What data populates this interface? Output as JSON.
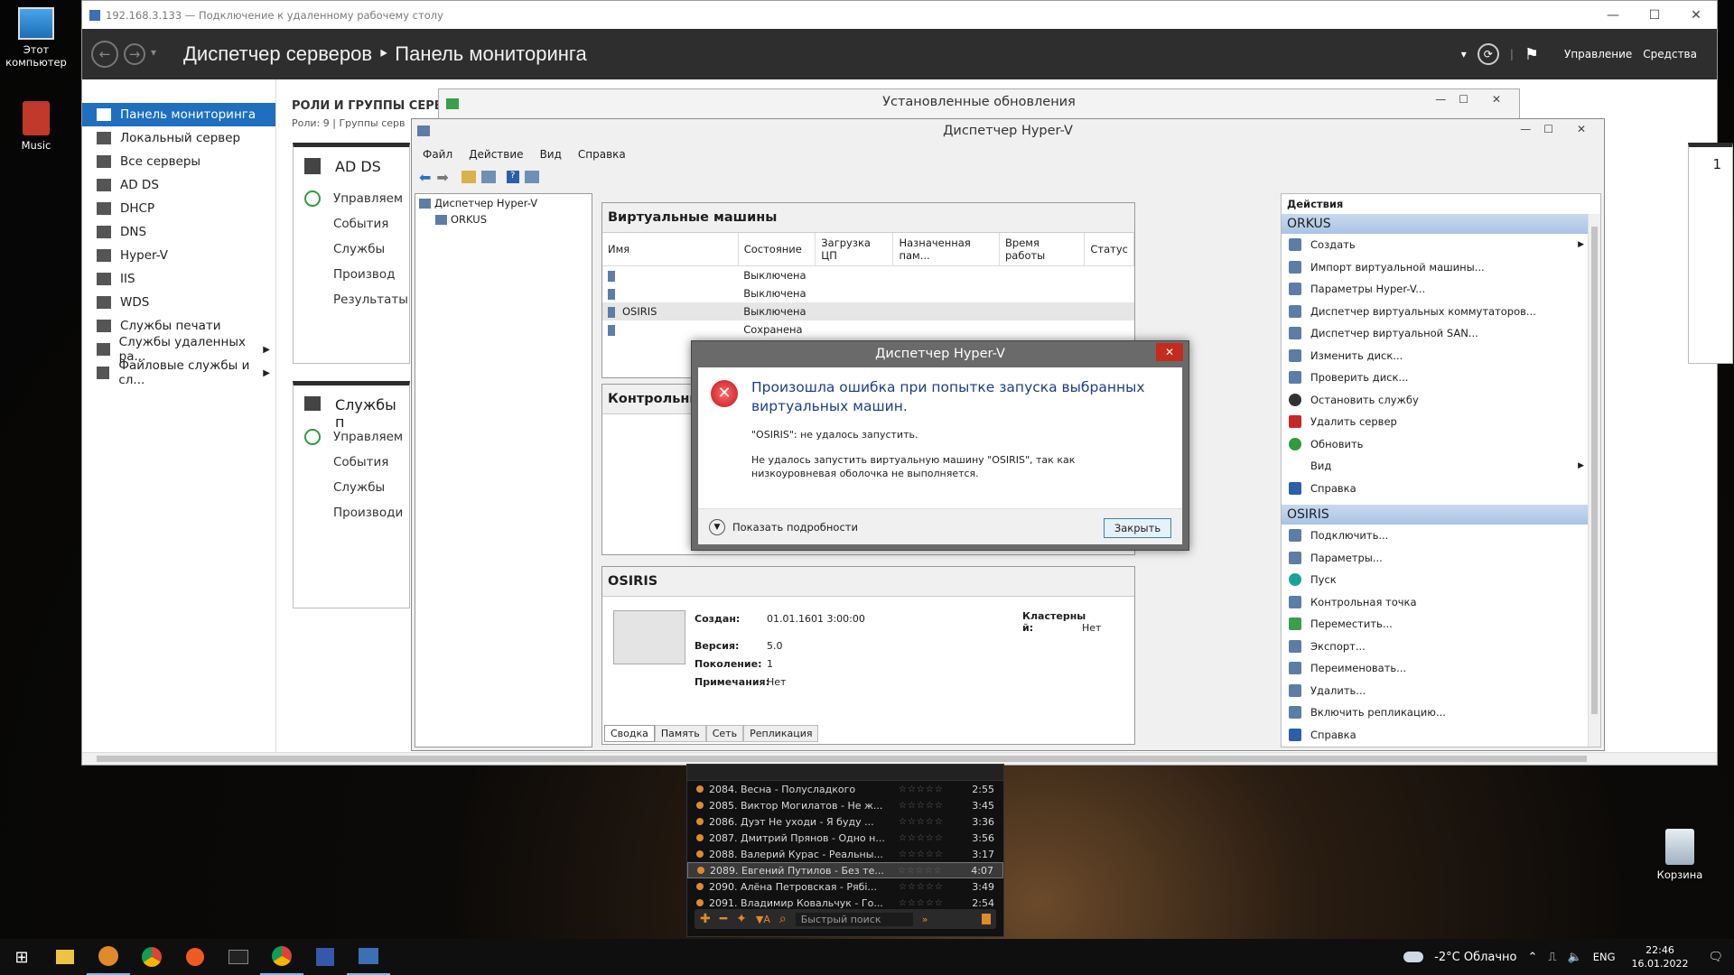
{
  "desktop": {
    "icons": [
      "Этот компьютер",
      "Music",
      "Корзина"
    ]
  },
  "rdp": {
    "title": "192.168.3.133 — Подключение к удаленному рабочему столу"
  },
  "server_manager": {
    "breadcrumb": "Диспетчер серверов ‣ Панель мониторинга",
    "header_right": [
      "Управление",
      "Средства"
    ],
    "nav": [
      {
        "label": "Панель мониторинга",
        "active": true
      },
      {
        "label": "Локальный сервер"
      },
      {
        "label": "Все серверы"
      },
      {
        "label": "AD DS"
      },
      {
        "label": "DHCP"
      },
      {
        "label": "DNS"
      },
      {
        "label": "Hyper-V"
      },
      {
        "label": "IIS"
      },
      {
        "label": "WDS"
      },
      {
        "label": "Службы печати"
      },
      {
        "label": "Службы удаленных ра..."
      },
      {
        "label": "Файловые службы и сл..."
      }
    ],
    "roles_heading": "РОЛИ И ГРУППЫ СЕРВ",
    "roles_sub": "Роли: 9 | Группы серв",
    "tile1": {
      "title": "AD DS",
      "rows": [
        "Управляем",
        "События",
        "Службы",
        "Производ",
        "Результаты"
      ]
    },
    "tile2": {
      "title": "Службы п",
      "rows": [
        "Управляем",
        "События",
        "Службы",
        "Производи"
      ]
    },
    "right_count": "1"
  },
  "updates_window": {
    "title": "Установленные обновления"
  },
  "hyperv": {
    "title": "Диспетчер Hyper-V",
    "menu": [
      "Файл",
      "Действие",
      "Вид",
      "Справка"
    ],
    "tree": {
      "root": "Диспетчер Hyper-V",
      "child": "ORKUS"
    },
    "vm_section": "Виртуальные машины",
    "columns": [
      "Имя",
      "Состояние",
      "Загрузка ЦП",
      "Назначенная пам...",
      "Время работы",
      "Статус"
    ],
    "vms": [
      {
        "name": "",
        "state": "Выключена"
      },
      {
        "name": "",
        "state": "Выключена"
      },
      {
        "name": "OSIRIS",
        "state": "Выключена"
      },
      {
        "name": "",
        "state": "Сохранена"
      }
    ],
    "checkpoints_section": "Контрольны",
    "details": {
      "title": "OSIRIS",
      "created_label": "Создан:",
      "created": "01.01.1601 3:00:00",
      "version_label": "Версия:",
      "version": "5.0",
      "generation_label": "Поколение:",
      "generation": "1",
      "notes_label": "Примечания:",
      "notes": "Нет",
      "cluster_label": "Кластерны й:",
      "cluster": "Нет",
      "tabs": [
        "Сводка",
        "Память",
        "Сеть",
        "Репликация"
      ]
    },
    "actions": {
      "heading": "Действия",
      "group1": "ORKUS",
      "group1_items": [
        "Создать",
        "Импорт виртуальной машины...",
        "Параметры Hyper-V...",
        "Диспетчер виртуальных коммутаторов...",
        "Диспетчер виртуальной SAN...",
        "Изменить диск...",
        "Проверить диск...",
        "Остановить службу",
        "Удалить сервер",
        "Обновить",
        "Вид",
        "Справка"
      ],
      "group2": "OSIRIS",
      "group2_items": [
        "Подключить...",
        "Параметры...",
        "Пуск",
        "Контрольная точка",
        "Переместить...",
        "Экспорт...",
        "Переименовать...",
        "Удалить...",
        "Включить репликацию...",
        "Справка"
      ]
    }
  },
  "dialog": {
    "title": "Диспетчер Hyper-V",
    "heading": "Произошла ошибка при попытке запуска выбранных виртуальных машин.",
    "line1": "\"OSIRIS\": не удалось запустить.",
    "line2": "Не удалось запустить виртуальную машину \"OSIRIS\", так как низкоуровневая оболочка не выполняется.",
    "details": "Показать подробности",
    "close": "Закрыть"
  },
  "player": {
    "tracks": [
      {
        "t": "2084. Весна - Полусладкого",
        "d": "2:55"
      },
      {
        "t": "2085. Виктор Могилатов - Не ж...",
        "d": "3:45"
      },
      {
        "t": "2086. Дуэт Не уходи - Я буду ...",
        "d": "3:36"
      },
      {
        "t": "2087. Дмитрий Прянов - Одно н...",
        "d": "3:56"
      },
      {
        "t": "2088. Валерий Курас - Реальны...",
        "d": "3:17"
      },
      {
        "t": "2089. Евгений Путилов - Без те...",
        "d": "4:07",
        "sel": true
      },
      {
        "t": "2090. Алёна Петровская - Рябі...",
        "d": "3:49"
      },
      {
        "t": "2091. Владимир Ковальчук - Го...",
        "d": "2:54"
      }
    ],
    "search": "Быстрый поиск"
  },
  "taskbar": {
    "weather": "-2°C  Облачно",
    "lang": "ENG",
    "time": "22:46",
    "date": "16.01.2022"
  }
}
